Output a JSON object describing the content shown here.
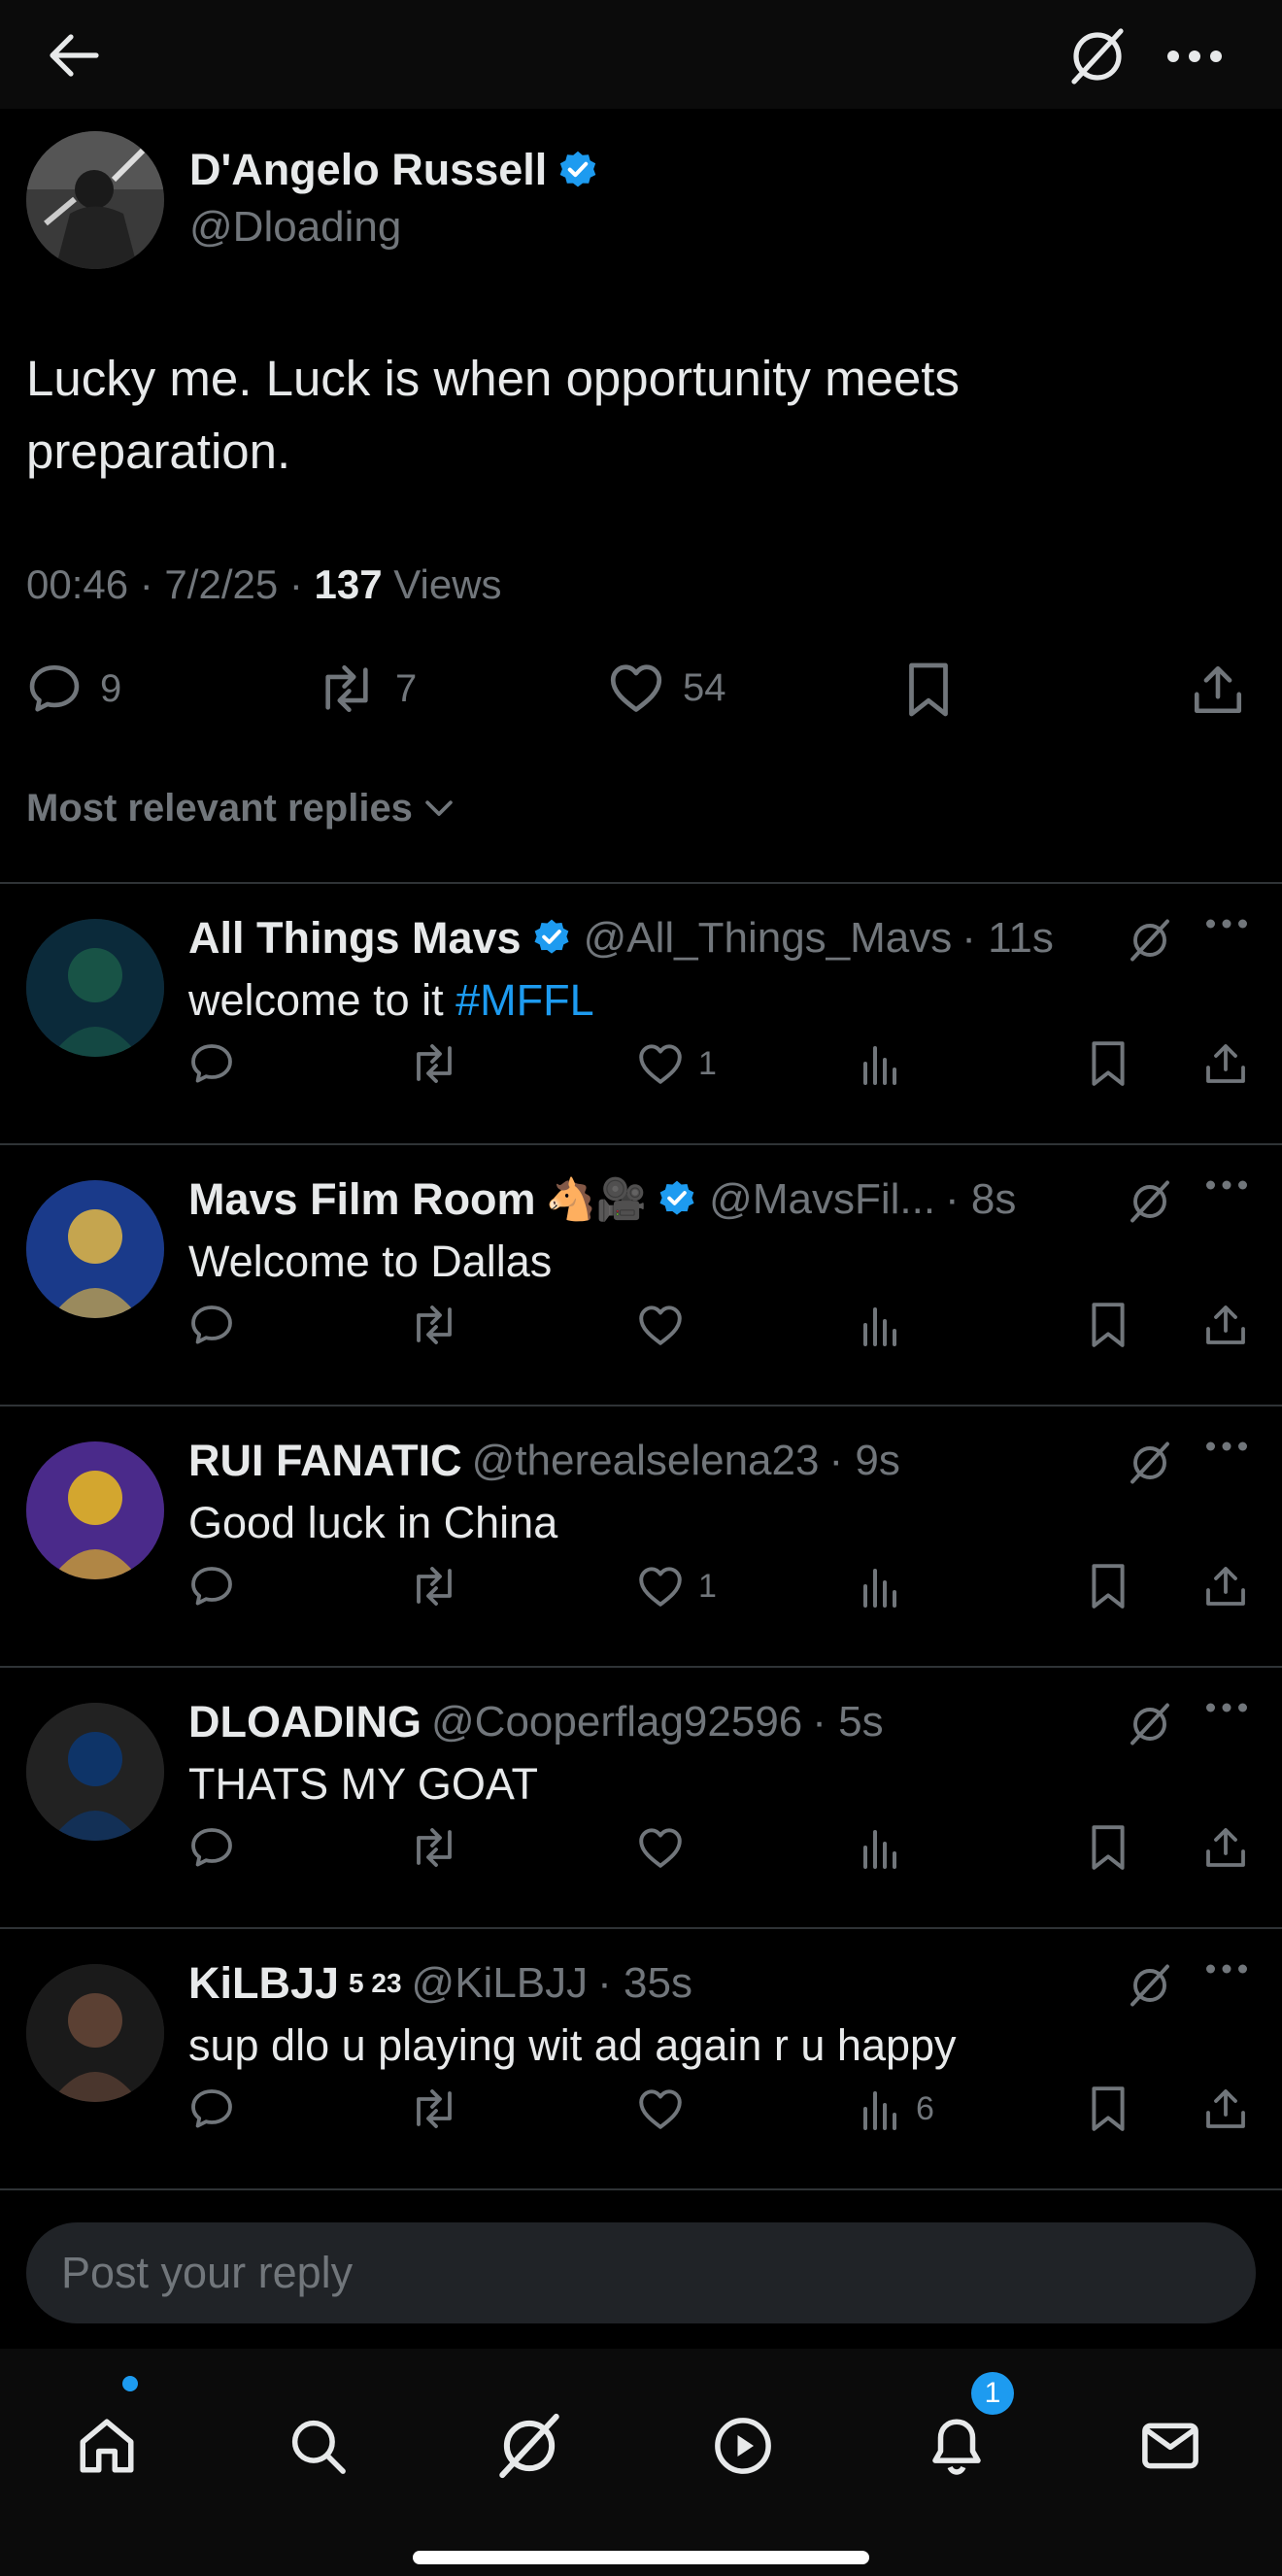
{
  "topbar": {
    "back_icon": "back-arrow-icon",
    "grok_icon": "grok-icon",
    "more_icon": "more-icon"
  },
  "post": {
    "author_name": "D'Angelo Russell",
    "author_handle": "@Dloading",
    "text_line1": "Lucky me. Luck is when opportunity meets",
    "text_line2": "preparation.",
    "time": "00:46 · 7/2/25 · ",
    "views_count": "137",
    "views_label": " Views",
    "replies": "9",
    "reposts": "7",
    "likes": "54"
  },
  "sort": {
    "label": "Most relevant replies"
  },
  "replies": [
    {
      "name": "All Things Mavs",
      "verified": true,
      "handle": "@All_Things_Mavs",
      "time": "· 11s",
      "text": "welcome to it ",
      "hashtag": "#MFFL",
      "likes": "1",
      "views": ""
    },
    {
      "name": "Mavs Film Room",
      "emoji": "🐴🎥",
      "verified": true,
      "handle": "@MavsFil...",
      "time": "· 8s",
      "text": "Welcome to Dallas",
      "likes": "",
      "views": ""
    },
    {
      "name": "RUI FANATIC",
      "verified": false,
      "handle": "@therealselena23",
      "time": "· 9s",
      "text": "Good luck in China",
      "likes": "1",
      "views": ""
    },
    {
      "name": "DLOADING",
      "verified": false,
      "handle": "@Cooperflag92596",
      "time": "· 5s",
      "text": "THATS MY GOAT",
      "likes": "",
      "views": ""
    },
    {
      "name": "KiLBJJ",
      "sup": "5 23",
      "verified": false,
      "handle": "@KiLBJJ",
      "time": "· 35s",
      "text": "sup dlo u playing wit ad again r u happy",
      "likes": "",
      "views": "6"
    }
  ],
  "composer": {
    "placeholder": "Post your reply"
  },
  "nav": {
    "notifications_badge": "1"
  },
  "colors": {
    "accent": "#1d9bf0",
    "muted": "#71767b",
    "text": "#e7e9ea",
    "background": "#000000"
  }
}
